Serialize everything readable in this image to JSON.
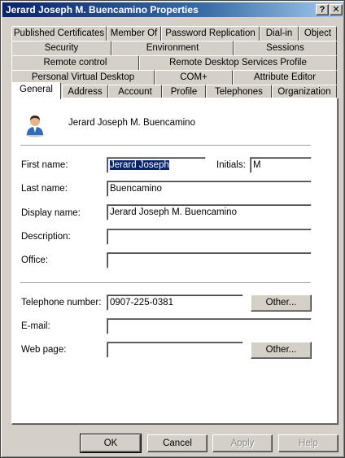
{
  "window": {
    "title": "Jerard Joseph M. Buencamino Properties",
    "help_label": "?",
    "close_label": "✕"
  },
  "tabs": {
    "row1": [
      "Published Certificates",
      "Member Of",
      "Password Replication",
      "Dial-in",
      "Object"
    ],
    "row2": [
      "Security",
      "Environment",
      "Sessions"
    ],
    "row3": [
      "Remote control",
      "Remote Desktop Services Profile"
    ],
    "row4": [
      "Personal Virtual Desktop",
      "COM+",
      "Attribute Editor"
    ],
    "row5": [
      "General",
      "Address",
      "Account",
      "Profile",
      "Telephones",
      "Organization"
    ],
    "active": "General"
  },
  "general": {
    "user_icon": "user-icon",
    "display_header": "Jerard Joseph M. Buencamino",
    "first_name_label": "First name:",
    "first_name_value": "Jerard Joseph",
    "initials_label": "Initials:",
    "initials_value": "M",
    "last_name_label": "Last name:",
    "last_name_value": "Buencamino",
    "display_name_label": "Display name:",
    "display_name_value": "Jerard Joseph M. Buencamino",
    "description_label": "Description:",
    "description_value": "",
    "office_label": "Office:",
    "office_value": "",
    "telephone_label": "Telephone number:",
    "telephone_value": "0907-225-0381",
    "email_label": "E-mail:",
    "email_value": "",
    "webpage_label": "Web page:",
    "webpage_value": "",
    "other_label": "Other..."
  },
  "buttons": {
    "ok": "OK",
    "cancel": "Cancel",
    "apply": "Apply",
    "help": "Help"
  }
}
